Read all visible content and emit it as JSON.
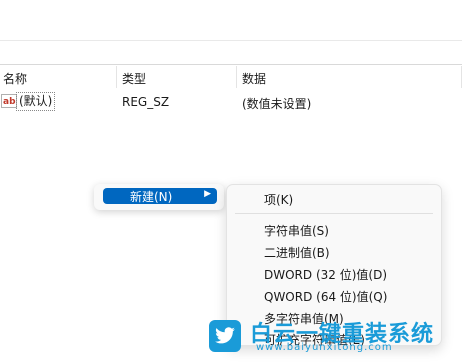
{
  "columns": {
    "name": "名称",
    "type": "类型",
    "data": "数据"
  },
  "row": {
    "name": "(默认)",
    "type": "REG_SZ",
    "data": "(数值未设置)"
  },
  "context_menu": {
    "new_label": "新建(N)"
  },
  "submenu": {
    "items": [
      "项(K)",
      "字符串值(S)",
      "二进制值(B)",
      "DWORD (32 位)值(D)",
      "QWORD (64 位)值(Q)",
      "多字符串值(M)",
      "可扩充字符串值(E)"
    ]
  },
  "watermark": {
    "title": "白云一键重装系统",
    "url": "www.baiyunxitong.com"
  },
  "colors": {
    "accent": "#0067c0",
    "watermark": "#1a9bd8"
  },
  "icons": {
    "string_value": "ab-icon",
    "submenu_arrow": "chevron-right-icon",
    "watermark_logo": "bird-logo-icon"
  }
}
